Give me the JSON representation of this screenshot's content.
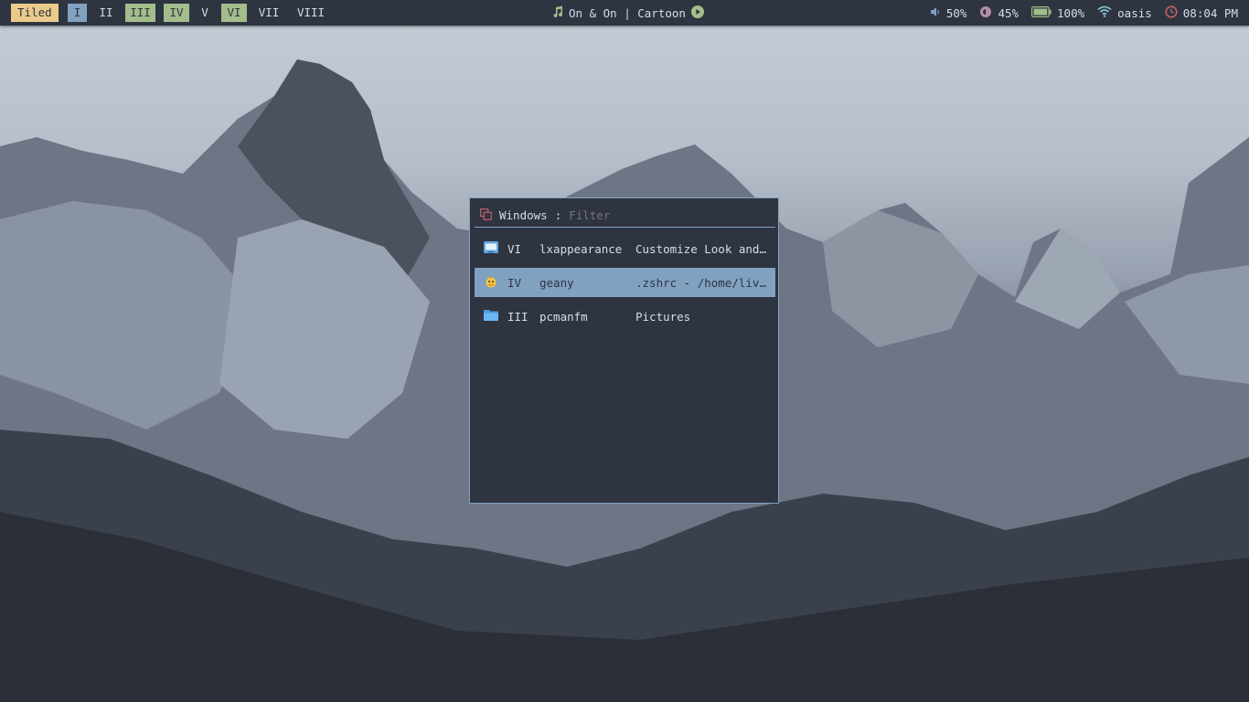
{
  "topbar": {
    "layout": "Tiled",
    "workspaces": [
      {
        "label": "I",
        "state": "focused"
      },
      {
        "label": "II",
        "state": "empty"
      },
      {
        "label": "III",
        "state": "occupied"
      },
      {
        "label": "IV",
        "state": "occupied"
      },
      {
        "label": "V",
        "state": "empty"
      },
      {
        "label": "VI",
        "state": "occupied"
      },
      {
        "label": "VII",
        "state": "empty"
      },
      {
        "label": "VIII",
        "state": "empty"
      }
    ],
    "music": {
      "icon": "music-note-icon",
      "text": "On & On | Cartoon",
      "control_icon": "play-icon"
    },
    "volume": {
      "icon": "volume-icon",
      "value": "50%"
    },
    "brightness": {
      "icon": "brightness-icon",
      "value": "45%"
    },
    "battery": {
      "icon": "battery-icon",
      "value": "100%"
    },
    "network": {
      "icon": "wifi-icon",
      "value": "oasis"
    },
    "clock": {
      "icon": "clock-icon",
      "value": "08:04 PM"
    }
  },
  "rofi": {
    "prompt": "Windows",
    "separator": ":",
    "filter_placeholder": "Filter",
    "entries": [
      {
        "icon": "lxappearance-icon",
        "workspace": "VI",
        "app": "lxappearance",
        "title": "Customize Look and Feel"
      },
      {
        "icon": "geany-icon",
        "workspace": "IV",
        "app": "geany",
        "title": ".zshrc - /home/liveuser - Geany"
      },
      {
        "icon": "folder-icon",
        "workspace": "III",
        "app": "pcmanfm",
        "title": "Pictures"
      }
    ]
  },
  "colors": {
    "bar_bg": "#2e3440",
    "fg": "#d8dee9",
    "focused": "#81a1c1",
    "occupied": "#a3be8c",
    "layout_badge": "#ebcb8b",
    "clock_icon": "#bf616a",
    "play_icon": "#a3be8c"
  }
}
